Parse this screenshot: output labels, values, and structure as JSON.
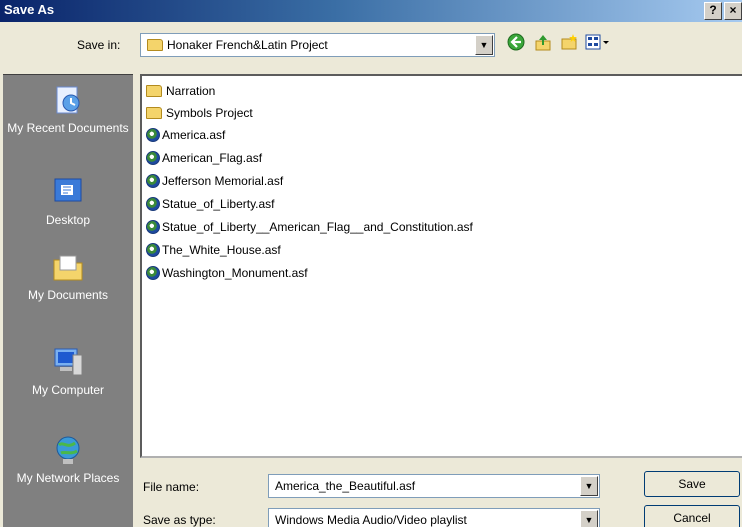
{
  "window": {
    "title": "Save As",
    "help_label": "?",
    "close_label": "×"
  },
  "save_in": {
    "label": "Save in:",
    "value": "Honaker French&Latin Project"
  },
  "toolbar": {
    "back_icon": "back-icon",
    "up_icon": "up-folder-icon",
    "new_folder_icon": "new-folder-icon",
    "views_icon": "views-menu-icon"
  },
  "places": [
    {
      "label": "My Recent Documents",
      "icon": "recent-documents-icon"
    },
    {
      "label": "Desktop",
      "icon": "desktop-icon"
    },
    {
      "label": "My Documents",
      "icon": "my-documents-icon"
    },
    {
      "label": "My Computer",
      "icon": "my-computer-icon"
    },
    {
      "label": "My Network Places",
      "icon": "network-places-icon"
    }
  ],
  "files": [
    {
      "name": "Narration",
      "type": "folder"
    },
    {
      "name": "Symbols Project",
      "type": "folder"
    },
    {
      "name": "America.asf",
      "type": "media"
    },
    {
      "name": "American_Flag.asf",
      "type": "media"
    },
    {
      "name": "Jefferson Memorial.asf",
      "type": "media"
    },
    {
      "name": "Statue_of_Liberty.asf",
      "type": "media"
    },
    {
      "name": "Statue_of_Liberty__American_Flag__and_Constitution.asf",
      "type": "media"
    },
    {
      "name": "The_White_House.asf",
      "type": "media"
    },
    {
      "name": "Washington_Monument.asf",
      "type": "media"
    }
  ],
  "file_name": {
    "label": "File name:",
    "value": "America_the_Beautiful.asf"
  },
  "save_as_type": {
    "label": "Save as type:",
    "value": "Windows Media Audio/Video playlist"
  },
  "buttons": {
    "save": "Save",
    "cancel": "Cancel"
  }
}
